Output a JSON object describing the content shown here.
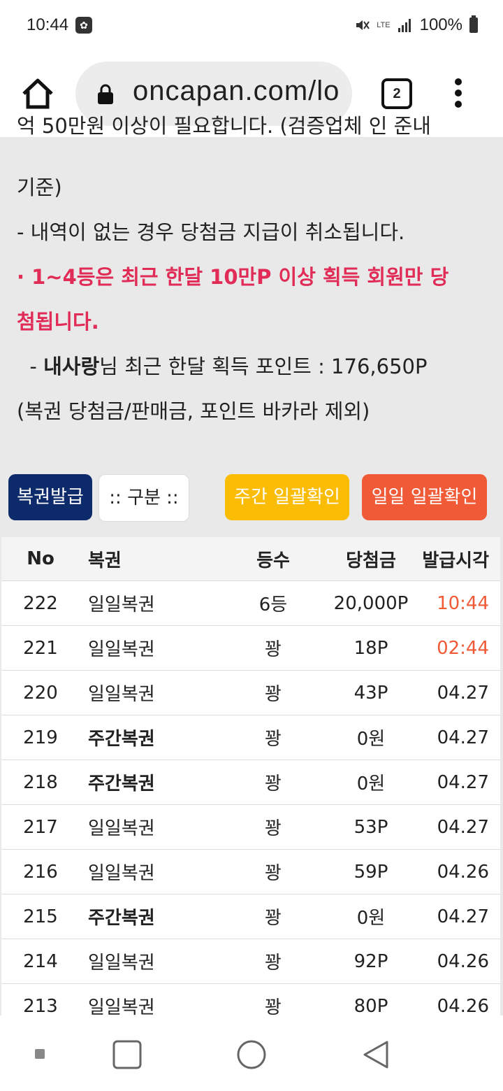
{
  "status": {
    "time": "10:44",
    "network": "LTE",
    "battery": "100%"
  },
  "browser": {
    "url": "oncapan.com/lo",
    "tab_count": "2"
  },
  "notice": {
    "cut_line": "억 50만원 이상이 필요합니다. (검증업체 인 준내",
    "line1": "기준)",
    "line2": "  - 내역이 없는 경우 당첨금 지급이 취소됩니다.",
    "line3": " · 1~4등은 최근 한달 10만P 이상 획득 회원만 당",
    "line4": "첨됩니다.",
    "line5_prefix": "  - ",
    "line5_user": "내사랑",
    "line5_rest": "님 최근 한달 획득 포인트 : 176,650P",
    "line6": "(복권 당첨금/판매금, 포인트 바카라 제외)"
  },
  "buttons": {
    "issue": "복권발급",
    "category": ":: 구분 ::",
    "weekly_check": "주간 일괄확인",
    "daily_check": "일일 일괄확인"
  },
  "table": {
    "headers": {
      "no": "No",
      "name": "복권",
      "rank": "등수",
      "prize": "당첨금",
      "time": "발급시각"
    },
    "rows": [
      {
        "no": "222",
        "name": "일일복권",
        "rank": "6등",
        "prize": "20,000P",
        "time": "10:44"
      },
      {
        "no": "221",
        "name": "일일복권",
        "rank": "꽝",
        "prize": "18P",
        "time": "02:44"
      },
      {
        "no": "220",
        "name": "일일복권",
        "rank": "꽝",
        "prize": "43P",
        "time": "04.27"
      },
      {
        "no": "219",
        "name": "주간복권",
        "rank": "꽝",
        "prize": "0원",
        "time": "04.27"
      },
      {
        "no": "218",
        "name": "주간복권",
        "rank": "꽝",
        "prize": "0원",
        "time": "04.27"
      },
      {
        "no": "217",
        "name": "일일복권",
        "rank": "꽝",
        "prize": "53P",
        "time": "04.27"
      },
      {
        "no": "216",
        "name": "일일복권",
        "rank": "꽝",
        "prize": "59P",
        "time": "04.26"
      },
      {
        "no": "215",
        "name": "주간복권",
        "rank": "꽝",
        "prize": "0원",
        "time": "04.27"
      },
      {
        "no": "214",
        "name": "일일복권",
        "rank": "꽝",
        "prize": "92P",
        "time": "04.26"
      },
      {
        "no": "213",
        "name": "일일복권",
        "rank": "꽝",
        "prize": "80P",
        "time": "04.26"
      }
    ]
  },
  "colors": {
    "accent_red": "#e02c57",
    "orange": "#f05a37",
    "navy": "#0d2a6b",
    "yellow": "#fbbc05"
  }
}
